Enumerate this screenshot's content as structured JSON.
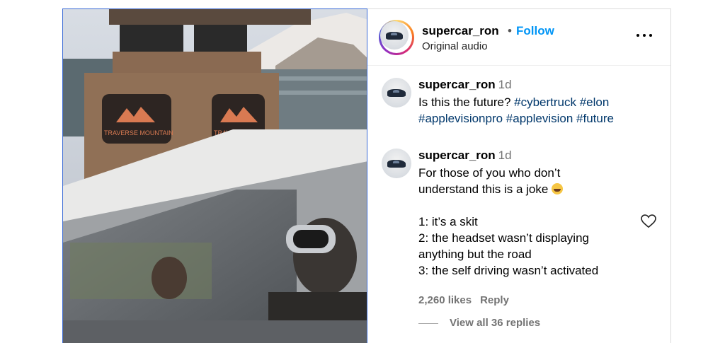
{
  "post": {
    "username": "supercar_ron",
    "follow_label": "Follow",
    "separator": "•",
    "audio": "Original audio",
    "more_icon": "more-horizontal-icon"
  },
  "media": {
    "sign_text_1": "TRAVERSE MOUNTAIN",
    "sign_text_2": "TRAVERSE MOUN"
  },
  "caption": {
    "username": "supercar_ron",
    "time": "1d",
    "text_plain": "Is this the future? ",
    "tags_line1": "#cybertruck #elon",
    "tags_line2": "#applevisionpro #applevision #future"
  },
  "comments": [
    {
      "username": "supercar_ron",
      "time": "1d",
      "lines": [
        "For those of you who don’t",
        "understand this is a joke",
        "",
        "1: it’s a skit",
        "2: the headset wasn’t displaying",
        "anything but the road",
        "3: the self driving wasn’t activated"
      ],
      "emoji": "😂",
      "likes": "2,260 likes",
      "reply_label": "Reply",
      "view_replies": "View all 36 replies"
    }
  ],
  "colors": {
    "follow": "#0095f6",
    "hashtag": "#00376b",
    "muted": "#737373"
  }
}
